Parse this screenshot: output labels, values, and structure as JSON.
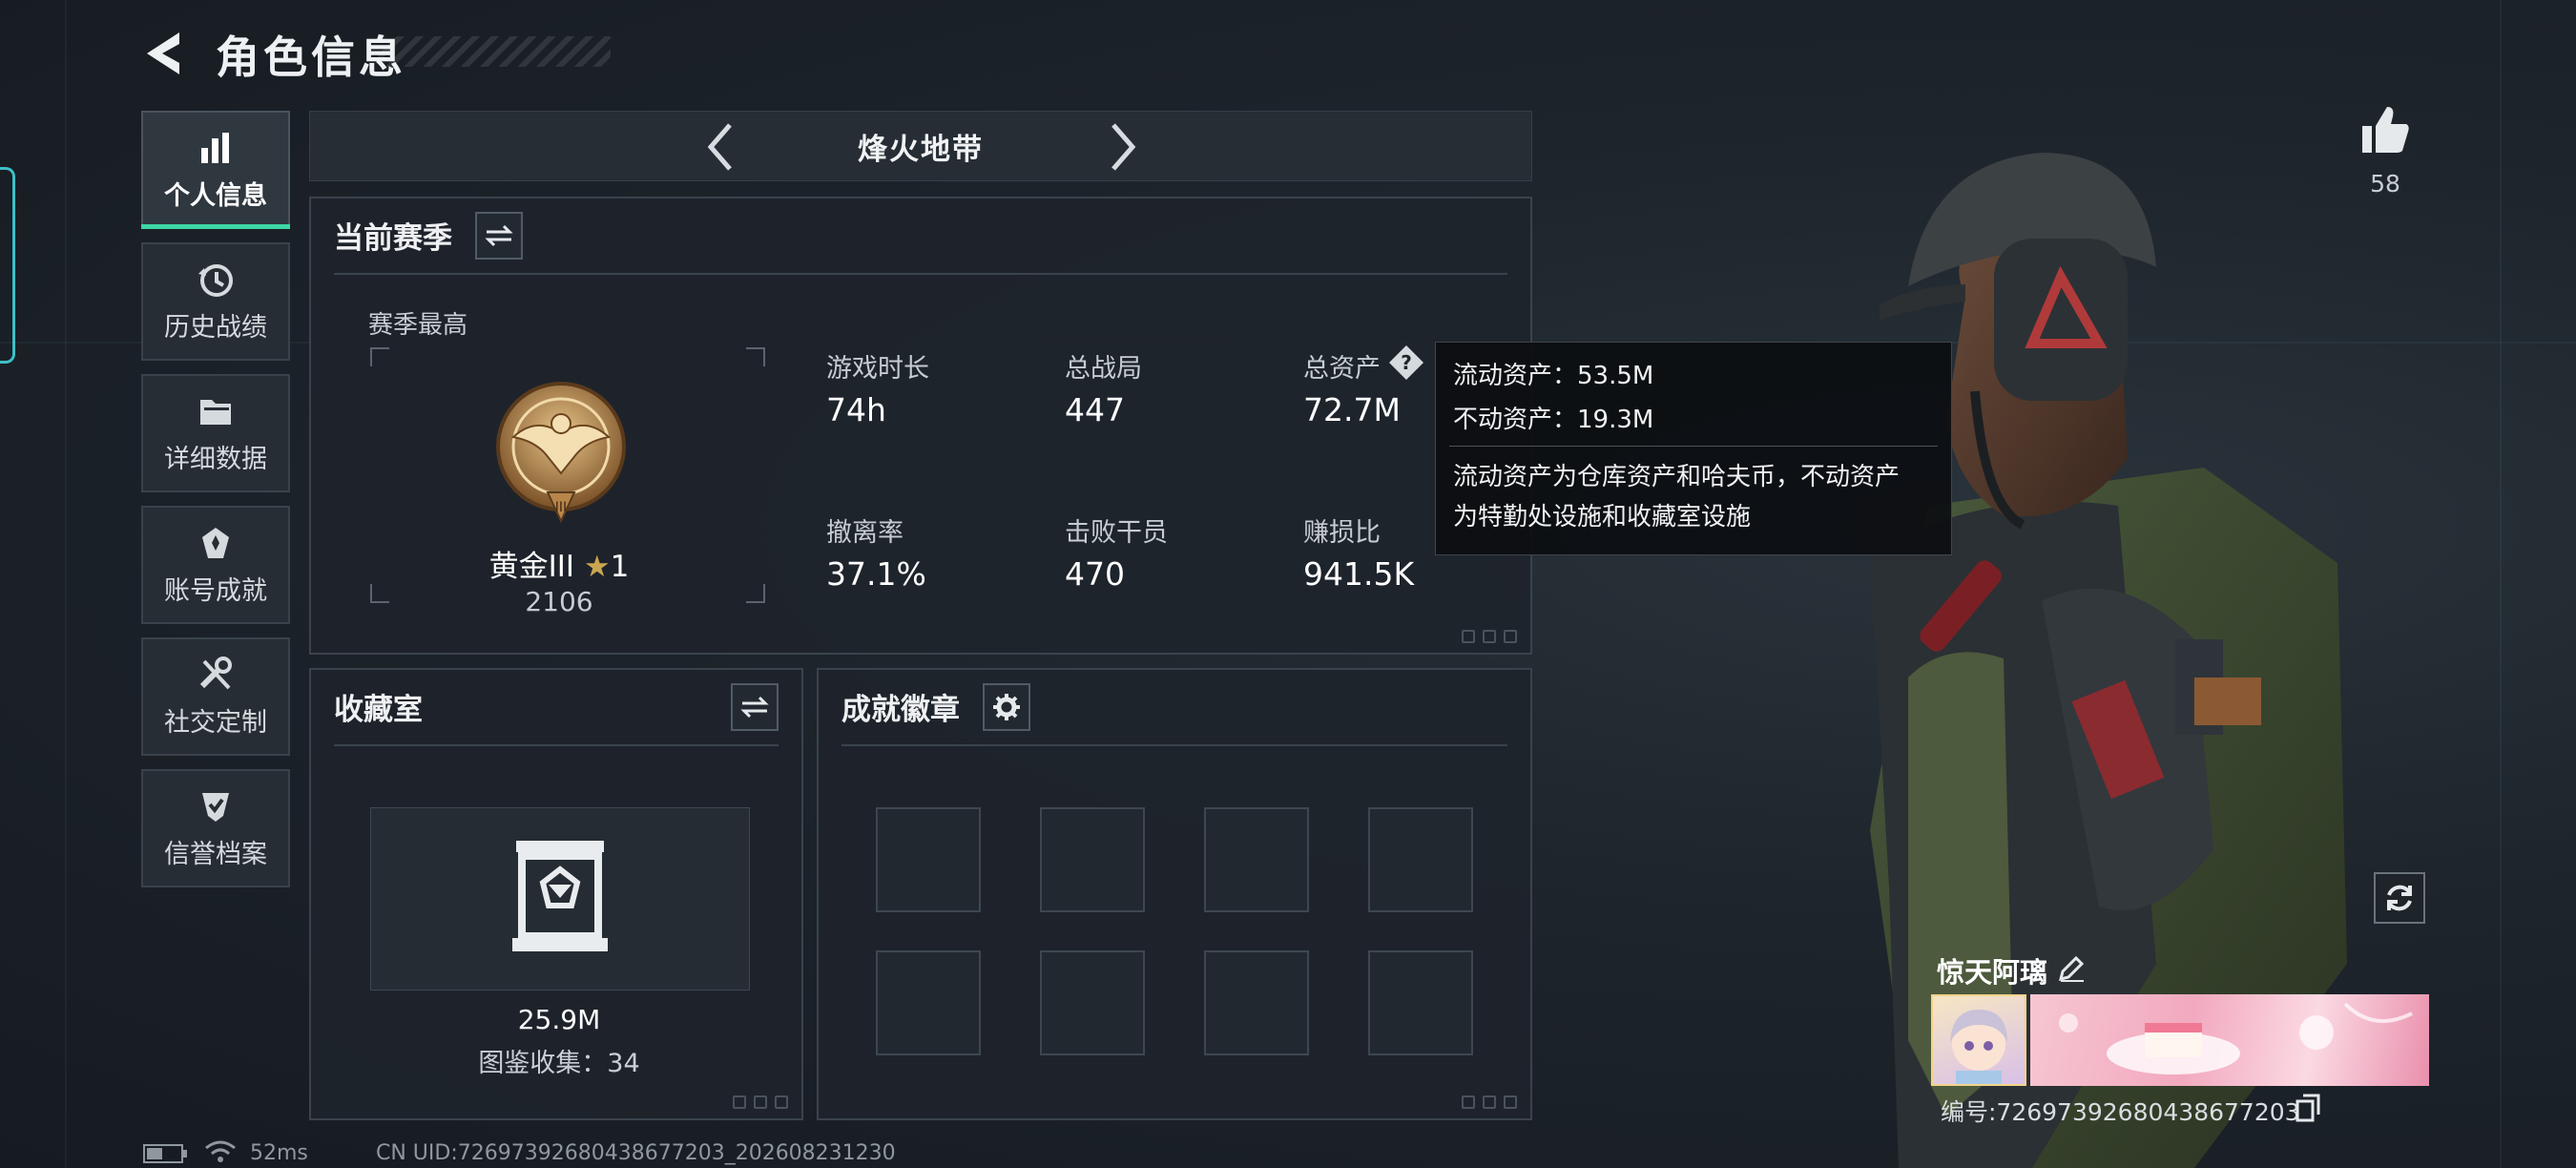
{
  "header": {
    "title": "角色信息"
  },
  "sidebar": {
    "items": [
      {
        "label": "个人信息",
        "icon": "bar-chart-icon",
        "active": true
      },
      {
        "label": "历史战绩",
        "icon": "history-clock-icon",
        "active": false
      },
      {
        "label": "详细数据",
        "icon": "folder-icon",
        "active": false
      },
      {
        "label": "账号成就",
        "icon": "medal-icon",
        "active": false
      },
      {
        "label": "社交定制",
        "icon": "tools-icon",
        "active": false
      },
      {
        "label": "信誉档案",
        "icon": "shield-check-icon",
        "active": false
      }
    ]
  },
  "mode": {
    "name": "烽火地带"
  },
  "season": {
    "title": "当前赛季",
    "best_label": "赛季最高",
    "rank_name": "黄金III",
    "rank_stars": "1",
    "rank_score": "2106",
    "stats": [
      {
        "label": "游戏时长",
        "value": "74h"
      },
      {
        "label": "总战局",
        "value": "447"
      },
      {
        "label": "总资产",
        "value": "72.7M"
      },
      {
        "label": "撤离率",
        "value": "37.1%"
      },
      {
        "label": "击败干员",
        "value": "470"
      },
      {
        "label": "赚损比",
        "value": "941.5K"
      }
    ]
  },
  "tooltip": {
    "liquid": "流动资产：53.5M",
    "fixed": "不动资产：19.3M",
    "desc1": "流动资产为仓库资产和哈夫币，不动资产",
    "desc2": "为特勤处设施和收藏室设施"
  },
  "collection": {
    "title": "收藏室",
    "value": "25.9M",
    "count": "图鉴收集：34"
  },
  "badges": {
    "title": "成就徽章",
    "slots": 8
  },
  "player": {
    "likes": "58",
    "name": "惊天阿璃",
    "uid": "编号:72697392680438677203"
  },
  "status": {
    "ping": "52ms",
    "uid": "CN UID:72697392680438677203_202608231230"
  },
  "colors": {
    "accent": "#3dd6a4",
    "panel": "#1e242b",
    "gold": "#c99a55"
  }
}
